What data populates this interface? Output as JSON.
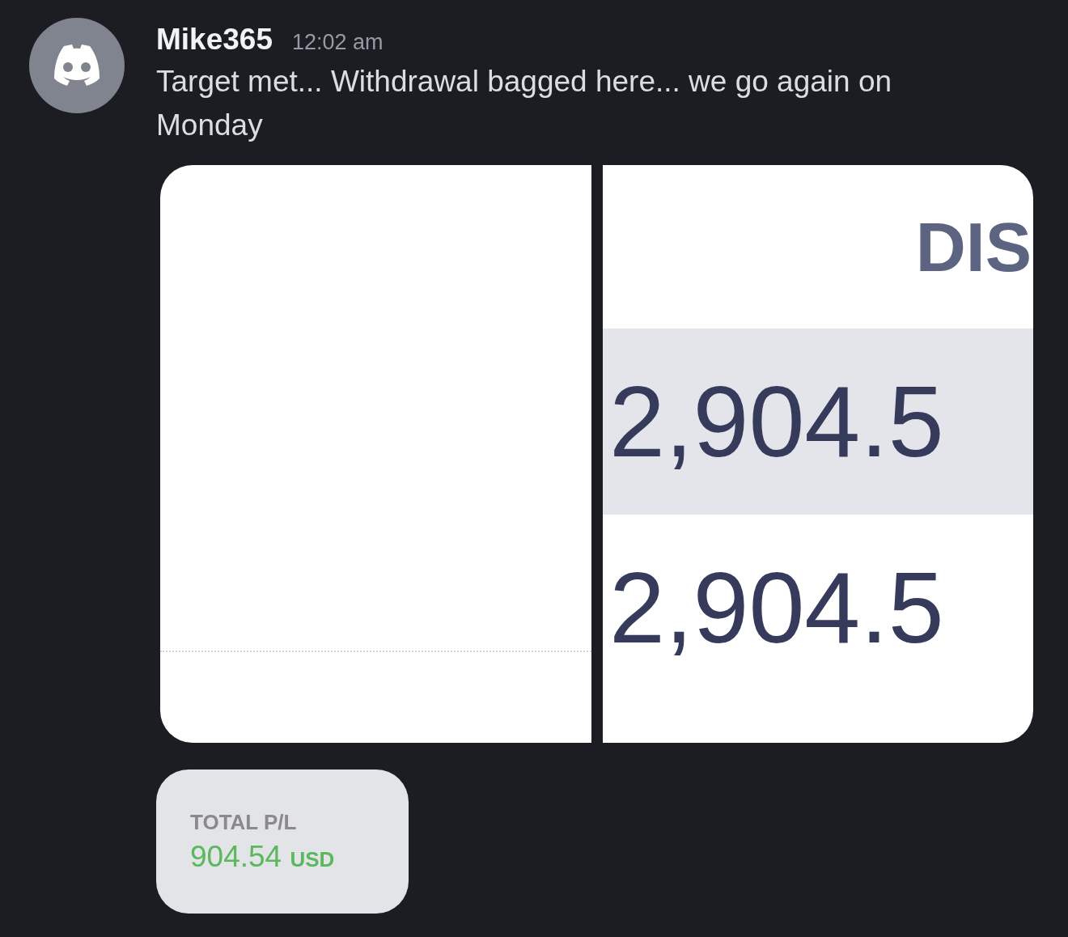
{
  "message": {
    "author": "Mike365",
    "timestamp": "12:02 am",
    "text": "Target met... Withdrawal bagged here... we go again on Monday"
  },
  "attachments": [
    {
      "kind": "blank"
    },
    {
      "kind": "table",
      "header": "DIS",
      "rows": [
        {
          "value": "2,904.5",
          "shaded": true
        },
        {
          "value": "2,904.5",
          "shaded": false
        }
      ]
    },
    {
      "kind": "summary",
      "label": "TOTAL P/L",
      "amount": "904.54",
      "currency": "USD"
    }
  ]
}
